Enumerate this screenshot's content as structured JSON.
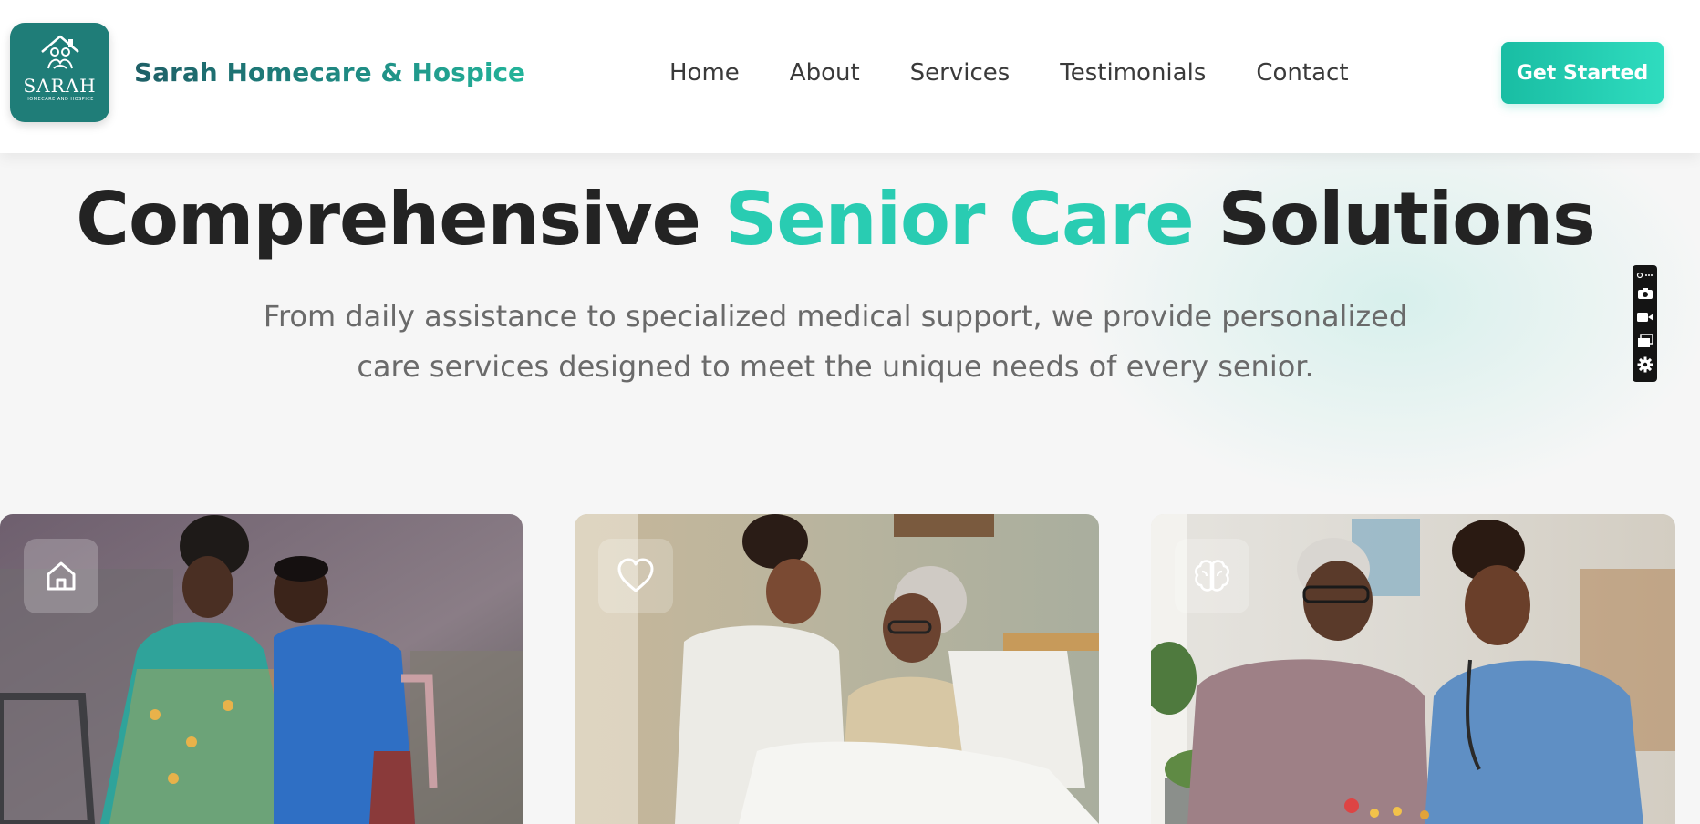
{
  "header": {
    "logo": {
      "word": "SARAH",
      "tagline": "HOMECARE AND HOSPICE",
      "icon": "house-family-icon"
    },
    "brand_name": "Sarah Homecare & Hospice",
    "nav": [
      {
        "label": "Home"
      },
      {
        "label": "About"
      },
      {
        "label": "Services"
      },
      {
        "label": "Testimonials"
      },
      {
        "label": "Contact"
      }
    ],
    "cta_label": "Get Started"
  },
  "hero": {
    "title_part1": "Comprehensive",
    "title_accent": "Senior Care",
    "title_part2": "Solutions",
    "subtitle": "From daily assistance to specialized medical support, we provide personalized care services designed to meet the unique needs of every senior."
  },
  "floating_toolbar": {
    "icons": [
      "link-more-icon",
      "camera-icon",
      "video-icon",
      "screens-icon",
      "gear-icon"
    ]
  },
  "service_cards": [
    {
      "icon": "home-icon",
      "image": "caregiver checking a woman's pulse outdoors"
    },
    {
      "icon": "heart-icon",
      "image": "nurse comforting elderly woman in bed"
    },
    {
      "icon": "brain-icon",
      "image": "nurse and elderly man doing a puzzle activity"
    }
  ],
  "colors": {
    "brand_teal": "#1f7d78",
    "accent": "#29ccb2",
    "heading": "#232323",
    "body_text": "#6a6a6a",
    "cta_start": "#19bda3",
    "cta_end": "#2fdcbf"
  }
}
